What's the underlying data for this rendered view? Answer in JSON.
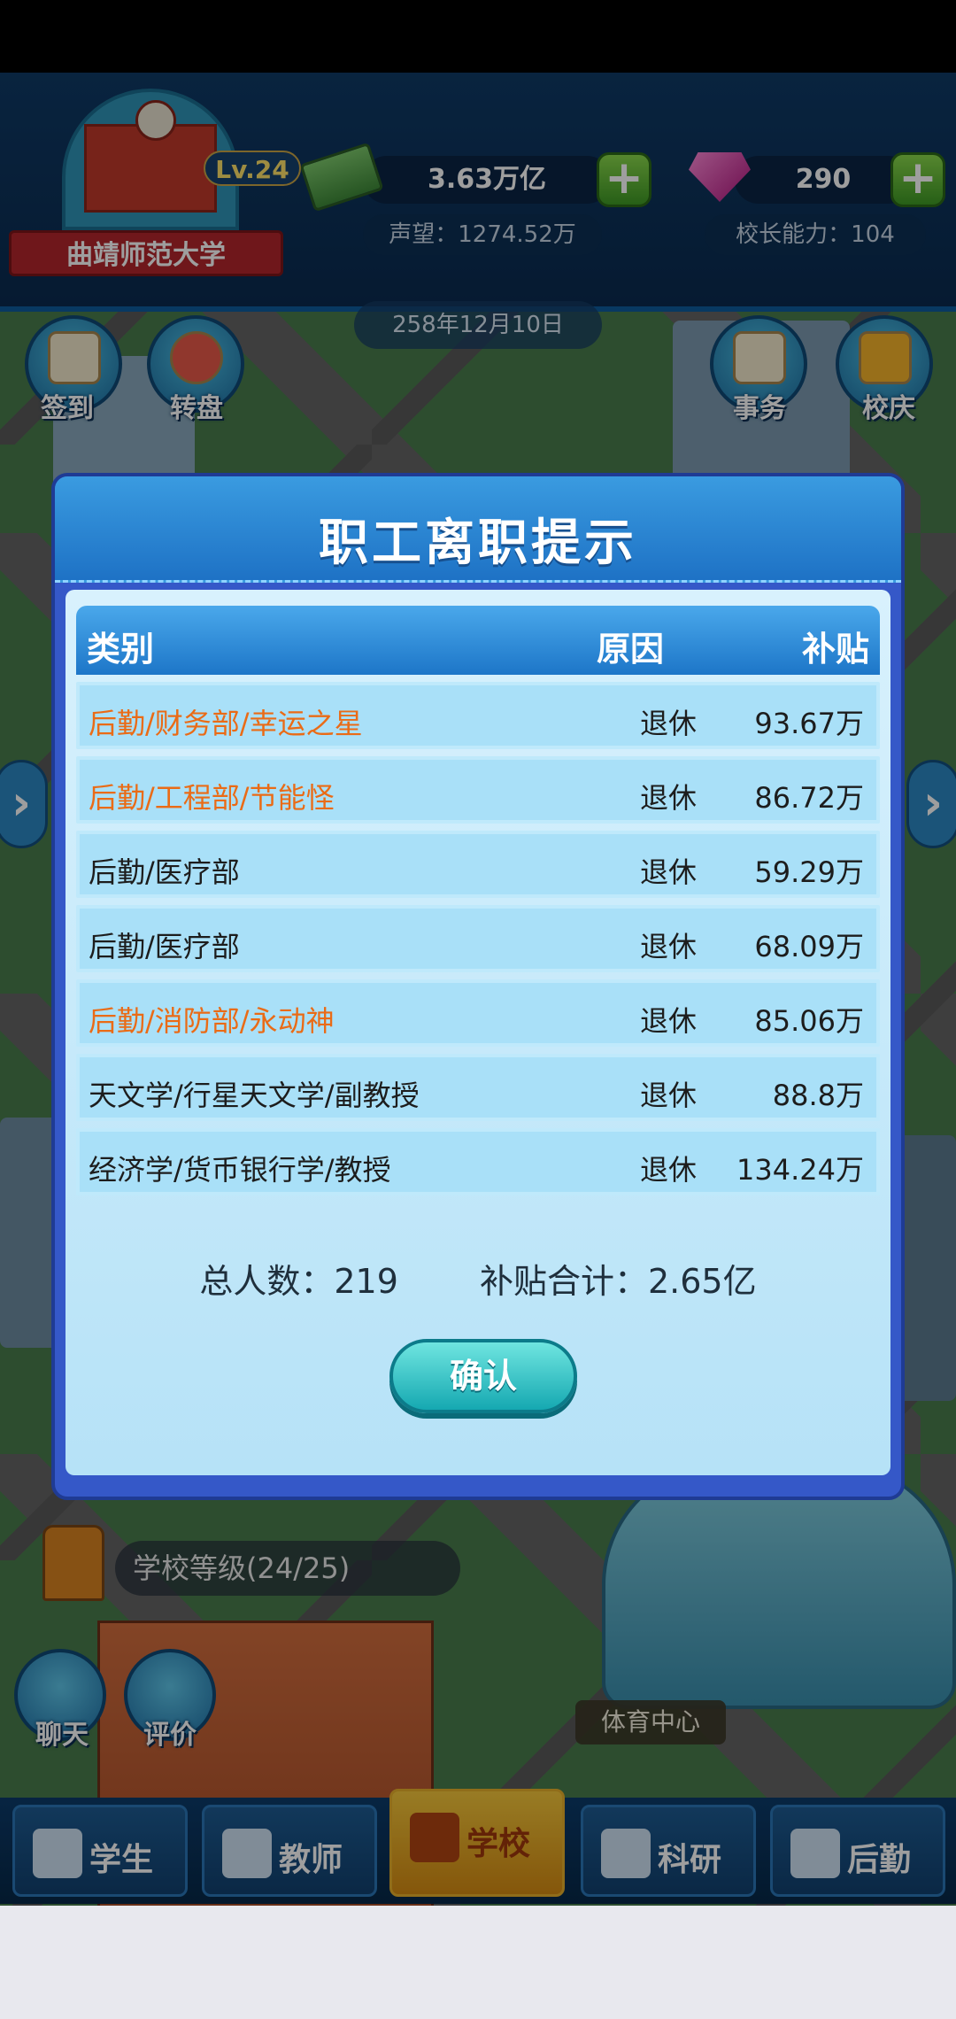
{
  "header": {
    "level": "Lv.24",
    "school_name": "曲靖师范大学",
    "money": "3.63万亿",
    "prestige": "声望：1274.52万",
    "gems": "290",
    "principal_ability": "校长能力：104",
    "date": "258年12月10日"
  },
  "side_buttons": {
    "checkin": "签到",
    "wheel": "转盘",
    "affairs": "事务",
    "anniversary": "校庆"
  },
  "dialog": {
    "title": "职工离职提示",
    "columns": [
      "类别",
      "原因",
      "补贴"
    ],
    "rows": [
      {
        "category": "后勤/财务部/幸运之星",
        "reason": "退休",
        "subsidy": "93.67万",
        "highlight": true
      },
      {
        "category": "后勤/工程部/节能怪",
        "reason": "退休",
        "subsidy": "86.72万",
        "highlight": true
      },
      {
        "category": "后勤/医疗部",
        "reason": "退休",
        "subsidy": "59.29万",
        "highlight": false
      },
      {
        "category": "后勤/医疗部",
        "reason": "退休",
        "subsidy": "68.09万",
        "highlight": false
      },
      {
        "category": "后勤/消防部/永动神",
        "reason": "退休",
        "subsidy": "85.06万",
        "highlight": true
      },
      {
        "category": "天文学/行星天文学/副教授",
        "reason": "退休",
        "subsidy": "88.8万",
        "highlight": false
      },
      {
        "category": "经济学/货币银行学/教授",
        "reason": "退休",
        "subsidy": "134.24万",
        "highlight": false
      }
    ],
    "total_people": "总人数：219",
    "total_subsidy": "补贴合计：2.65亿",
    "confirm_label": "确认"
  },
  "background_ui": {
    "school_level": "学校等级(24/25)",
    "chat": "聊天",
    "review": "评价",
    "sports_center": "体育中心"
  },
  "nav": {
    "students": "学生",
    "teachers": "教师",
    "school": "学校",
    "research": "科研",
    "logistics": "后勤"
  },
  "colors": {
    "highlight_text": "#ea6b16",
    "dialog_frame": "#3558c8",
    "confirm_button": "#15a8b1"
  }
}
